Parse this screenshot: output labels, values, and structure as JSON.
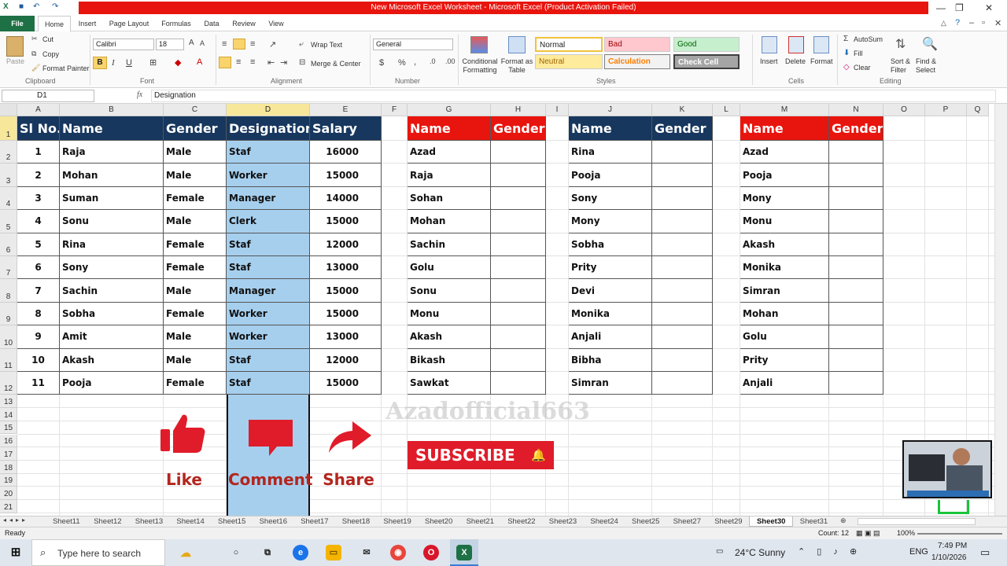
{
  "titlebar": {
    "title": "New Microsoft Excel Worksheet - Microsoft Excel (Product Activation Failed)"
  },
  "tabs": [
    "File",
    "Home",
    "Insert",
    "Page Layout",
    "Formulas",
    "Data",
    "Review",
    "View"
  ],
  "ribbon": {
    "clipboard": {
      "paste": "Paste",
      "cut": "Cut",
      "copy": "Copy",
      "format_painter": "Format Painter",
      "label": "Clipboard"
    },
    "font": {
      "name": "Calibri",
      "size": "18",
      "label": "Font",
      "bold": "B",
      "italic": "I",
      "underline": "U"
    },
    "alignment": {
      "wrap": "Wrap Text",
      "merge": "Merge & Center",
      "label": "Alignment"
    },
    "number": {
      "format": "General",
      "currency": "$",
      "percent": "%",
      "comma": ",",
      "label": "Number"
    },
    "styles": {
      "cond": "Conditional Formatting",
      "table": "Format as Table",
      "normal": "Normal",
      "bad": "Bad",
      "good": "Good",
      "neutral": "Neutral",
      "calculation": "Calculation",
      "check": "Check Cell",
      "label": "Styles"
    },
    "cells": {
      "insert": "Insert",
      "delete": "Delete",
      "format": "Format",
      "label": "Cells"
    },
    "editing": {
      "autosum": "AutoSum",
      "fill": "Fill",
      "clear": "Clear",
      "sort": "Sort & Filter",
      "find": "Find & Select",
      "label": "Editing"
    }
  },
  "formula_bar": {
    "name_box": "D1",
    "fx": "fx",
    "value": "Designation"
  },
  "columns": [
    "A",
    "B",
    "C",
    "D",
    "E",
    "F",
    "G",
    "H",
    "I",
    "J",
    "K",
    "L",
    "M",
    "N",
    "O",
    "P",
    "Q"
  ],
  "rows": [
    "1",
    "2",
    "3",
    "4",
    "5",
    "6",
    "7",
    "8",
    "9",
    "10",
    "11",
    "12",
    "13",
    "14",
    "15",
    "16",
    "17",
    "18",
    "19",
    "20",
    "21"
  ],
  "table_main": {
    "headers": [
      "Sl No.",
      "Name",
      "Gender",
      "Designation",
      "Salary"
    ],
    "rows": [
      [
        "1",
        "Raja",
        "Male",
        "Staf",
        "16000"
      ],
      [
        "2",
        "Mohan",
        "Male",
        "Worker",
        "15000"
      ],
      [
        "3",
        "Suman",
        "Female",
        "Manager",
        "14000"
      ],
      [
        "4",
        "Sonu",
        "Male",
        "Clerk",
        "15000"
      ],
      [
        "5",
        "Rina",
        "Female",
        "Staf",
        "12000"
      ],
      [
        "6",
        "Sony",
        "Female",
        "Staf",
        "13000"
      ],
      [
        "7",
        "Sachin",
        "Male",
        "Manager",
        "15000"
      ],
      [
        "8",
        "Sobha",
        "Female",
        "Worker",
        "15000"
      ],
      [
        "9",
        "Amit",
        "Male",
        "Worker",
        "13000"
      ],
      [
        "10",
        "Akash",
        "Male",
        "Staf",
        "12000"
      ],
      [
        "11",
        "Pooja",
        "Female",
        "Staf",
        "15000"
      ]
    ]
  },
  "table_g": {
    "headers": [
      "Name",
      "Gender"
    ],
    "names": [
      "Azad",
      "Raja",
      "Sohan",
      "Mohan",
      "Sachin",
      "Golu",
      "Sonu",
      "Monu",
      "Akash",
      "Bikash",
      "Sawkat"
    ]
  },
  "table_j": {
    "headers": [
      "Name",
      "Gender"
    ],
    "names": [
      "Rina",
      "Pooja",
      "Sony",
      "Mony",
      "Sobha",
      "Prity",
      "Devi",
      "Monika",
      "Anjali",
      "Bibha",
      "Simran"
    ]
  },
  "table_m": {
    "headers": [
      "Name",
      "Gender"
    ],
    "names": [
      "Azad",
      "Pooja",
      "Mony",
      "Monu",
      "Akash",
      "Monika",
      "Simran",
      "Mohan",
      "Golu",
      "Prity",
      "Anjali"
    ]
  },
  "overlay": {
    "like": "Like",
    "comment": "Comment",
    "share": "Share",
    "subscribe": "SUBSCRIBE",
    "watermark": "Azadofficial663"
  },
  "sheet_tabs": [
    "Sheet11",
    "Sheet12",
    "Sheet13",
    "Sheet14",
    "Sheet15",
    "Sheet16",
    "Sheet17",
    "Sheet18",
    "Sheet19",
    "Sheet20",
    "Sheet21",
    "Sheet22",
    "Sheet23",
    "Sheet24",
    "Sheet25",
    "Sheet27",
    "Sheet29",
    "Sheet30",
    "Sheet31"
  ],
  "active_sheet": "Sheet30",
  "status": {
    "ready": "Ready",
    "count": "Count: 12",
    "zoom": "100%"
  },
  "taskbar": {
    "search": "Type here to search",
    "weather": "24°C  Sunny",
    "lang": "ENG",
    "time": "7:49 PM",
    "date": "1/10/2026"
  },
  "colors": {
    "navy": "#17375e",
    "red": "#e8150e",
    "selection": "#a6cfee",
    "excel_green": "#1e7145"
  }
}
